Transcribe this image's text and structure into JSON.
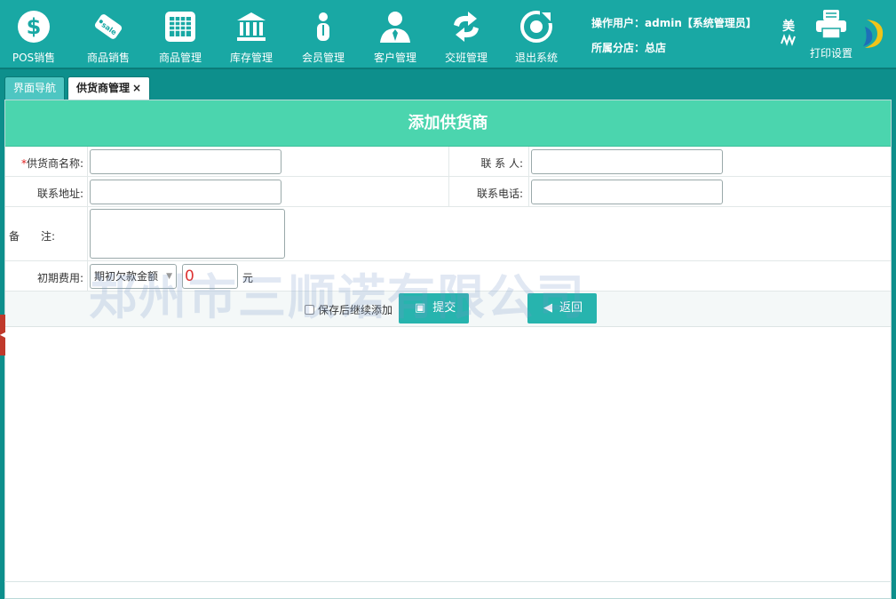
{
  "nav": {
    "items": [
      {
        "label": "POS销售",
        "icon": "dollar-icon"
      },
      {
        "label": "商品销售",
        "icon": "sale-tag-icon"
      },
      {
        "label": "商品管理",
        "icon": "grid-table-icon"
      },
      {
        "label": "库存管理",
        "icon": "bank-icon"
      },
      {
        "label": "会员管理",
        "icon": "member-icon"
      },
      {
        "label": "客户管理",
        "icon": "customer-icon"
      },
      {
        "label": "交班管理",
        "icon": "swap-icon"
      },
      {
        "label": "退出系统",
        "icon": "exit-icon"
      }
    ],
    "operator_label": "操作用户：",
    "operator_value": "admin【系统管理员】",
    "branch_label": "所属分店：",
    "branch_value": "总店",
    "mei_text": "美",
    "print_label": "打印设置"
  },
  "tabs": [
    {
      "label": "界面导航"
    },
    {
      "label": "供货商管理",
      "close": "×"
    }
  ],
  "form": {
    "title": "添加供货商",
    "supplier_name": {
      "required_mark": "*",
      "label": "供货商名称:",
      "value": ""
    },
    "contact": {
      "label": "联 系 人:",
      "value": ""
    },
    "address": {
      "label": "联系地址:",
      "value": ""
    },
    "phone": {
      "label": "联系电话:",
      "value": ""
    },
    "remark": {
      "label": "备　　注:",
      "value": ""
    },
    "initial_fee": {
      "label": "初期费用:",
      "type_selected": "期初欠款金额",
      "amount": "0",
      "unit": "元"
    },
    "continue_checkbox": "保存后继续添加",
    "submit_label": "提交",
    "back_label": "返回"
  },
  "watermark": "郑州市三顺诺有限公司",
  "colors": {
    "header_bg": "#19a8a4",
    "title_bar": "#4bd5ae",
    "button": "#27b4ae",
    "required": "#e02020"
  }
}
